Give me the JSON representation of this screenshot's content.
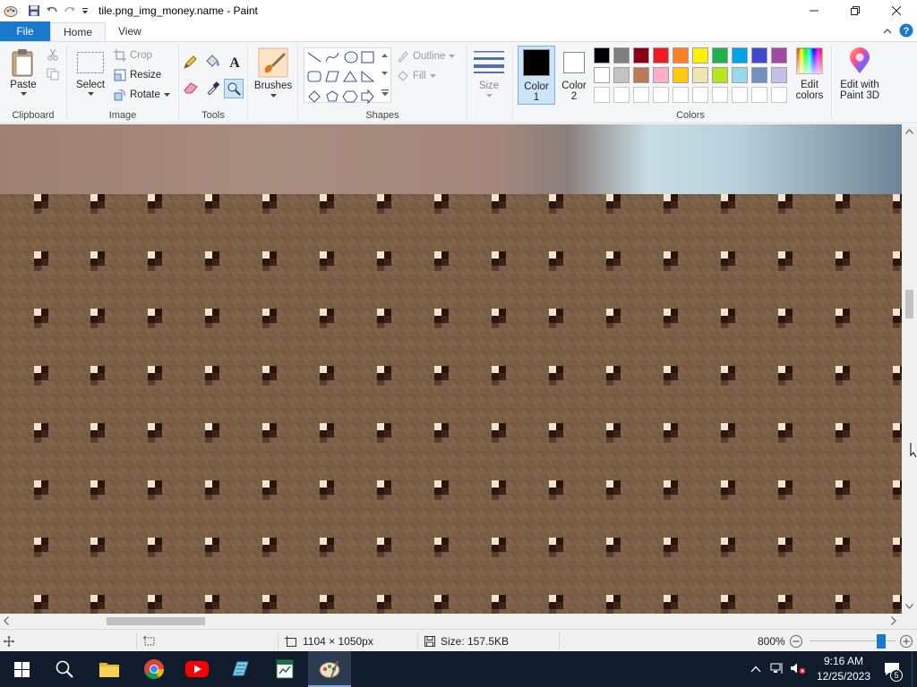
{
  "window": {
    "title": "tile.png_img_money.name - Paint",
    "minimize": "—",
    "maximize": "❐",
    "close": "✕"
  },
  "tabs": [
    {
      "label": "File"
    },
    {
      "label": "Home"
    },
    {
      "label": "View"
    }
  ],
  "ribbon": {
    "clipboard": {
      "group_label": "Clipboard",
      "paste": "Paste"
    },
    "image": {
      "group_label": "Image",
      "select": "Select",
      "crop": "Crop",
      "resize": "Resize",
      "rotate": "Rotate"
    },
    "tools": {
      "group_label": "Tools"
    },
    "brushes": {
      "label": "Brushes"
    },
    "shapes": {
      "group_label": "Shapes",
      "outline": "Outline",
      "fill": "Fill"
    },
    "size": {
      "label": "Size"
    },
    "color1": {
      "label": "Color",
      "num": "1",
      "value": "#000000"
    },
    "color2": {
      "label": "Color",
      "num": "2",
      "value": "#ffffff"
    },
    "colors": {
      "group_label": "Colors",
      "row1": [
        "#000000",
        "#7f7f7f",
        "#880015",
        "#ed1c24",
        "#ff7f27",
        "#fff200",
        "#22b14c",
        "#00a2e8",
        "#3f48cc",
        "#a349a4"
      ],
      "row2": [
        "#ffffff",
        "#c3c3c3",
        "#b97a57",
        "#ffaec9",
        "#ffc90e",
        "#efe4b0",
        "#b5e61d",
        "#99d9ea",
        "#7092be",
        "#c8bfe7"
      ]
    },
    "edit_colors": {
      "line1": "Edit",
      "line2": "colors"
    },
    "paint3d": {
      "line1": "Edit with",
      "line2": "Paint 3D"
    }
  },
  "status": {
    "dimensions": "1104 × 1050px",
    "size": "Size: 157.5KB",
    "zoom": "800%",
    "zoom_fraction": 0.83
  },
  "taskbar": {
    "time": "9:16 AM",
    "date": "12/25/2023",
    "notifications": "5"
  }
}
